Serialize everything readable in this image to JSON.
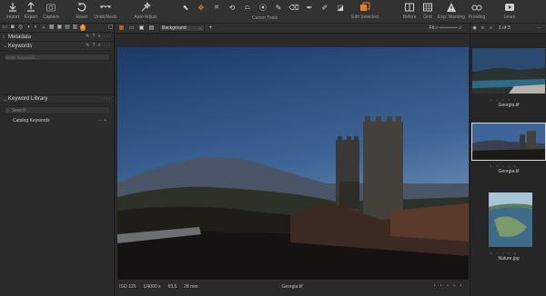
{
  "toolbar": {
    "left_buttons": [
      {
        "label": "Import",
        "icon": "import-icon"
      },
      {
        "label": "Export",
        "icon": "export-icon"
      },
      {
        "label": "Capture",
        "icon": "capture-icon"
      },
      {
        "label": "Reset",
        "icon": "reset-icon"
      },
      {
        "label": "Undo/Redo",
        "icon": "undo-redo-icon"
      },
      {
        "label": "Auto Adjust",
        "icon": "auto-adjust-icon"
      }
    ],
    "cursor_tools_label": "Cursor Tools",
    "edit_selected_label": "Edit Selected",
    "right_buttons": [
      {
        "label": "Before",
        "icon": "before-icon"
      },
      {
        "label": "Grid",
        "icon": "grid-icon"
      },
      {
        "label": "Exp. Warning",
        "icon": "exposure-warning-icon"
      },
      {
        "label": "Proofing",
        "icon": "proofing-icon"
      },
      {
        "label": "Learn",
        "icon": "learn-icon"
      }
    ]
  },
  "left_panel": {
    "metadata_label": "Metadata",
    "keywords_label": "Keywords",
    "keywords_placeholder": "Enter Keywords...",
    "keyword_library_label": "Keyword Library",
    "search_placeholder": "Search",
    "catalog_keywords_label": "Catalog Keywords"
  },
  "viewer": {
    "background_select": "Background",
    "fit_label": "Fit",
    "iso": "ISO 125",
    "shutter": "1/4000 s",
    "aperture": "f/3.5",
    "focal": "28 mm",
    "filename": "Georgia.tif",
    "dots": "• • • • •"
  },
  "filmstrip": {
    "count": "1 of 3",
    "items": [
      {
        "name": "Georgia.tif",
        "selected": false,
        "stars": "• • • • •"
      },
      {
        "name": "Georgia.tif",
        "selected": true,
        "stars": "• • • • •"
      },
      {
        "name": "Nature.jpg",
        "selected": false,
        "stars": "• • • • •"
      }
    ]
  },
  "colors": {
    "accent": "#e87e22",
    "panel": "#2b2b2b",
    "toolbar": "#323232"
  }
}
